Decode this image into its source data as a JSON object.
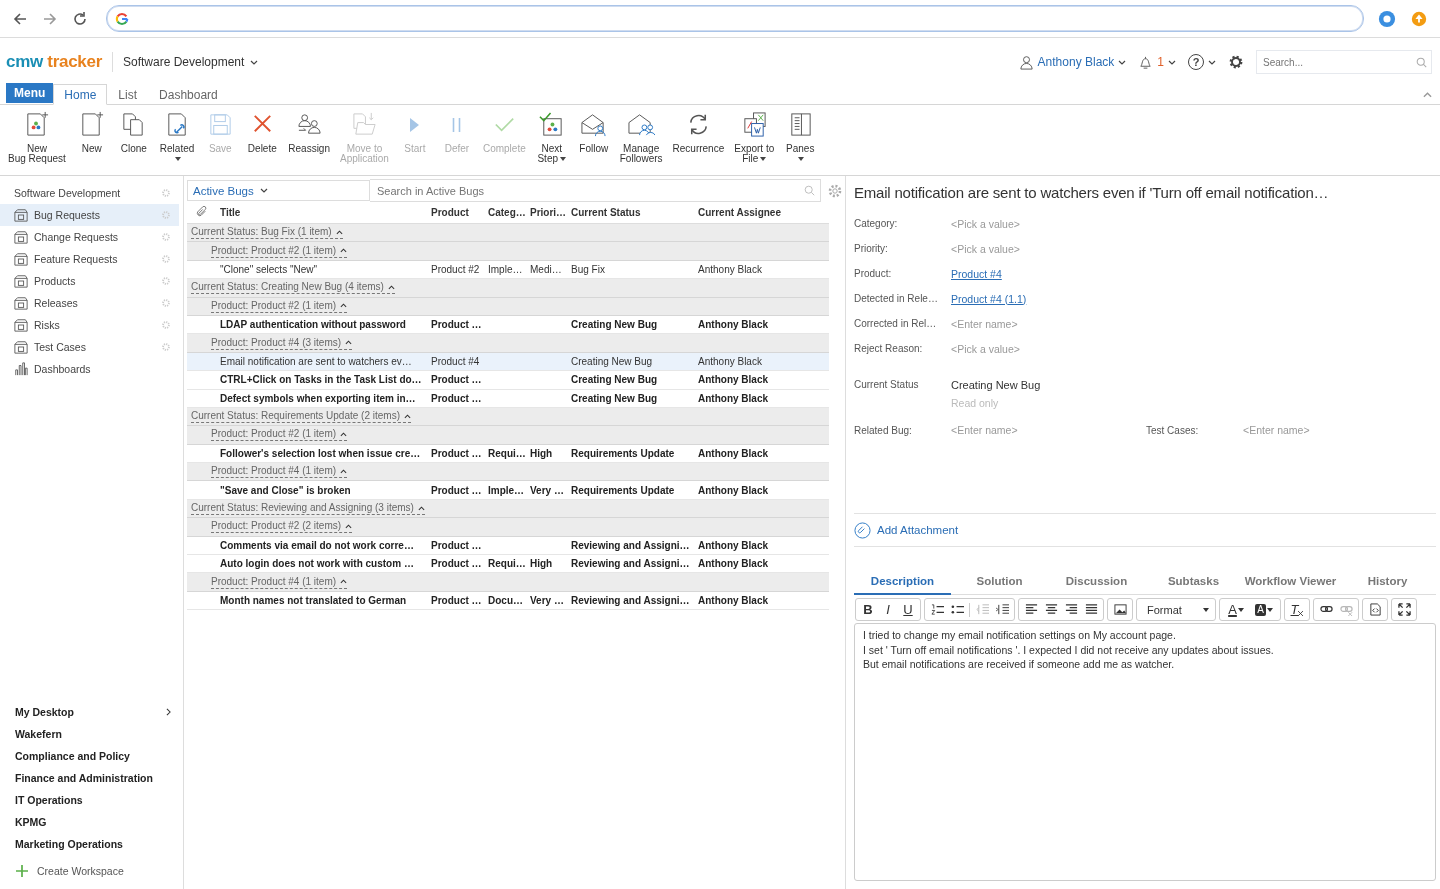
{
  "app": {
    "logo": {
      "part_1": "cmw",
      "part_2": "tracker"
    },
    "workspace": "Software Development",
    "user": "Anthony Black",
    "notifications": "1",
    "help": "?",
    "search": {
      "placeholder": "Search..."
    }
  },
  "menu_button": "Menu",
  "tabs": [
    {
      "label": "Home",
      "selected": true
    },
    {
      "label": "List",
      "selected": false
    },
    {
      "label": "Dashboard",
      "selected": false
    }
  ],
  "ribbon": [
    {
      "lines": [
        "New",
        "Bug Request"
      ],
      "kind": "newrecord",
      "disabled": false,
      "dropdown": false
    },
    {
      "lines": [
        "New"
      ],
      "kind": "new",
      "disabled": false,
      "dropdown": false
    },
    {
      "lines": [
        "Clone"
      ],
      "kind": "clone",
      "disabled": false,
      "dropdown": false
    },
    {
      "lines": [
        "Related"
      ],
      "kind": "related",
      "disabled": false,
      "dropdown": true
    },
    {
      "lines": [
        "Save"
      ],
      "kind": "save",
      "disabled": true,
      "dropdown": false
    },
    {
      "lines": [
        "Delete"
      ],
      "kind": "delete",
      "disabled": false,
      "dropdown": false
    },
    {
      "lines": [
        "Reassign"
      ],
      "kind": "reassign",
      "disabled": false,
      "dropdown": false
    },
    {
      "lines": [
        "Move to",
        "Application"
      ],
      "kind": "move",
      "disabled": true,
      "dropdown": false
    },
    {
      "lines": [
        "Start"
      ],
      "kind": "start",
      "disabled": true,
      "dropdown": false
    },
    {
      "lines": [
        "Defer"
      ],
      "kind": "defer",
      "disabled": true,
      "dropdown": false
    },
    {
      "lines": [
        "Complete"
      ],
      "kind": "complete",
      "disabled": true,
      "dropdown": false
    },
    {
      "lines": [
        "Next",
        "Step"
      ],
      "kind": "nextstep",
      "disabled": false,
      "dropdown": true
    },
    {
      "lines": [
        "Follow"
      ],
      "kind": "follow",
      "disabled": false,
      "dropdown": false
    },
    {
      "lines": [
        "Manage",
        "Followers"
      ],
      "kind": "followers",
      "disabled": false,
      "dropdown": false
    },
    {
      "lines": [
        "Recurrence"
      ],
      "kind": "recurrence",
      "disabled": false,
      "dropdown": false
    },
    {
      "lines": [
        "Export to",
        "File"
      ],
      "kind": "export",
      "disabled": false,
      "dropdown": true
    },
    {
      "lines": [
        "Panes"
      ],
      "kind": "panes",
      "disabled": false,
      "dropdown": true
    }
  ],
  "sidebar": {
    "workspace": "Software Development",
    "items": [
      {
        "label": "Bug Requests",
        "kind": "app",
        "selected": true
      },
      {
        "label": "Change Requests",
        "kind": "app",
        "selected": false
      },
      {
        "label": "Feature Requests",
        "kind": "app",
        "selected": false
      },
      {
        "label": "Products",
        "kind": "app",
        "selected": false
      },
      {
        "label": "Releases",
        "kind": "app",
        "selected": false
      },
      {
        "label": "Risks",
        "kind": "app",
        "selected": false
      },
      {
        "label": "Test Cases",
        "kind": "app",
        "selected": false
      },
      {
        "label": "Dashboards",
        "kind": "dashboard",
        "selected": false
      }
    ],
    "workspaces": [
      {
        "label": "My Desktop",
        "expandable": true
      },
      {
        "label": "Wakefern",
        "expandable": false
      },
      {
        "label": "Compliance and Policy",
        "expandable": false
      },
      {
        "label": "Finance and Administration",
        "expandable": false
      },
      {
        "label": "IT Operations",
        "expandable": false
      },
      {
        "label": "KPMG",
        "expandable": false
      },
      {
        "label": "Marketing Operations",
        "expandable": false
      }
    ],
    "create": "Create Workspace"
  },
  "list": {
    "view": "Active Bugs",
    "search": {
      "placeholder": "Search in Active Bugs"
    },
    "columns": [
      "Title",
      "Product",
      "Categ…",
      "Priori…",
      "Current Status",
      "Current Assignee"
    ],
    "groups": [
      {
        "label": "Current Status: Bug Fix (1 item)",
        "expanded": true,
        "children": [
          {
            "label": "Product: Product #2 (1 item)",
            "expanded": true,
            "children": [
              {
                "title": "\"Clone\" selects \"New\"",
                "product": "Product #2",
                "category": "Imple…",
                "priority": "Medi…",
                "status": "Bug Fix",
                "assignee": "Anthony Black",
                "bold": false,
                "selected": false
              }
            ]
          }
        ]
      },
      {
        "label": "Current Status: Creating New Bug (4 items)",
        "expanded": true,
        "children": [
          {
            "label": "Product: Product #2 (1 item)",
            "expanded": true,
            "children": [
              {
                "title": "LDAP authentication without password",
                "product": "Product …",
                "status": "Creating New Bug",
                "assignee": "Anthony Black",
                "bold": true,
                "selected": false
              }
            ]
          },
          {
            "label": "Product: Product #4 (3 items)",
            "expanded": true,
            "children": [
              {
                "title": "Email notification are sent to watchers ev…",
                "product": "Product #4",
                "status": "Creating New Bug",
                "assignee": "Anthony Black",
                "bold": false,
                "selected": true
              },
              {
                "title": "CTRL+Click on Tasks in the Task List do…",
                "product": "Product …",
                "status": "Creating New Bug",
                "assignee": "Anthony Black",
                "bold": true,
                "selected": false
              },
              {
                "title": "Defect symbols when exporting item in…",
                "product": "Product …",
                "status": "Creating New Bug",
                "assignee": "Anthony Black",
                "bold": true,
                "selected": false
              }
            ]
          }
        ]
      },
      {
        "label": "Current Status: Requirements Update (2 items)",
        "expanded": true,
        "children": [
          {
            "label": "Product: Product #2 (1 item)",
            "expanded": true,
            "children": [
              {
                "title": "Follower's selection lost when issue cre…",
                "product": "Product …",
                "category": "Requi…",
                "priority": "High",
                "status": "Requirements Update",
                "assignee": "Anthony Black",
                "bold": true,
                "selected": false
              }
            ]
          },
          {
            "label": "Product: Product #4 (1 item)",
            "expanded": true,
            "children": [
              {
                "title": "\"Save and Close\" is broken",
                "product": "Product …",
                "category": "Imple…",
                "priority": "Very …",
                "status": "Requirements Update",
                "assignee": "Anthony Black",
                "bold": true,
                "selected": false
              }
            ]
          }
        ]
      },
      {
        "label": "Current Status: Reviewing and Assigning (3 items)",
        "expanded": true,
        "children": [
          {
            "label": "Product: Product #2 (2 items)",
            "expanded": true,
            "children": [
              {
                "title": "Comments via email do not work corre…",
                "product": "Product …",
                "status": "Reviewing and Assigni…",
                "assignee": "Anthony Black",
                "bold": true,
                "selected": false
              },
              {
                "title": "Auto login does not work with custom …",
                "product": "Product …",
                "category": "Requi…",
                "priority": "High",
                "status": "Reviewing and Assigni…",
                "assignee": "Anthony Black",
                "bold": true,
                "selected": false
              }
            ]
          },
          {
            "label": "Product: Product #4 (1 item)",
            "expanded": true,
            "children": [
              {
                "title": "Month names not translated to German",
                "product": "Product …",
                "category": "Docu…",
                "priority": "Very …",
                "status": "Reviewing and Assigni…",
                "assignee": "Anthony Black",
                "bold": true,
                "selected": false
              }
            ]
          }
        ]
      }
    ]
  },
  "detail": {
    "title": "Email notification are sent to watchers even if 'Turn off email notification…",
    "fields": [
      {
        "label": "Category:",
        "placeholder": "<Pick a value>",
        "kind": "empty"
      },
      {
        "label": "Priority:",
        "placeholder": "<Pick a value>",
        "kind": "empty"
      },
      {
        "label": "Product:",
        "value": "Product #4",
        "kind": "link"
      },
      {
        "label": "Detected in Rele…",
        "value": "Product #4 (1.1)",
        "kind": "link"
      },
      {
        "label": "Corrected in Rel…",
        "placeholder": "<Enter name>",
        "kind": "empty"
      },
      {
        "label": "Reject Reason:",
        "placeholder": "<Pick a value>",
        "kind": "empty"
      }
    ],
    "status": {
      "label": "Current Status",
      "value": "Creating New Bug",
      "note": "Read only"
    },
    "pair": [
      {
        "label": "Related Bug:",
        "placeholder": "<Enter name>",
        "kind": "empty"
      },
      {
        "label": "Test Cases:",
        "placeholder": "<Enter name>",
        "kind": "empty"
      }
    ],
    "attachment": "Add Attachment",
    "tabs": [
      {
        "label": "Description",
        "selected": true
      },
      {
        "label": "Solution",
        "selected": false
      },
      {
        "label": "Discussion",
        "selected": false
      },
      {
        "label": "Subtasks",
        "selected": false
      },
      {
        "label": "Workflow Viewer",
        "selected": false
      },
      {
        "label": "History",
        "selected": false
      }
    ],
    "editor": {
      "groups": [
        [
          {
            "kind": "bold",
            "text": "B",
            "disabled": false
          },
          {
            "kind": "italic",
            "text": "I",
            "disabled": false
          },
          {
            "kind": "underline",
            "text": "U",
            "disabled": false
          }
        ],
        [
          {
            "kind": "numbered",
            "disabled": false
          },
          {
            "kind": "bullets",
            "disabled": false
          },
          {
            "kind": "outdent",
            "disabled": true
          },
          {
            "kind": "indent",
            "disabled": false
          }
        ],
        [
          {
            "kind": "left",
            "disabled": false
          },
          {
            "kind": "center",
            "disabled": false
          },
          {
            "kind": "right",
            "disabled": false
          },
          {
            "kind": "justify",
            "disabled": false
          }
        ],
        [
          {
            "kind": "image",
            "disabled": false
          }
        ],
        [
          {
            "kind": "format",
            "text": "Format"
          }
        ],
        [
          {
            "kind": "color",
            "text": "A",
            "disabled": false
          },
          {
            "kind": "background",
            "text": "A",
            "disabled": false
          }
        ],
        [
          {
            "kind": "clear",
            "text": "T",
            "disabled": false
          }
        ],
        [
          {
            "kind": "link",
            "disabled": false
          },
          {
            "kind": "unlink",
            "disabled": true
          }
        ],
        [
          {
            "kind": "source",
            "disabled": false
          }
        ],
        [
          {
            "kind": "maximize",
            "disabled": false
          }
        ]
      ],
      "lines": [
        "I tried to change my email notification settings on My account page.",
        "I set ' Turn off email notifications '. I expected I did not receive any updates about issues.",
        "But email notifications are received if someone add me as watcher."
      ]
    }
  }
}
